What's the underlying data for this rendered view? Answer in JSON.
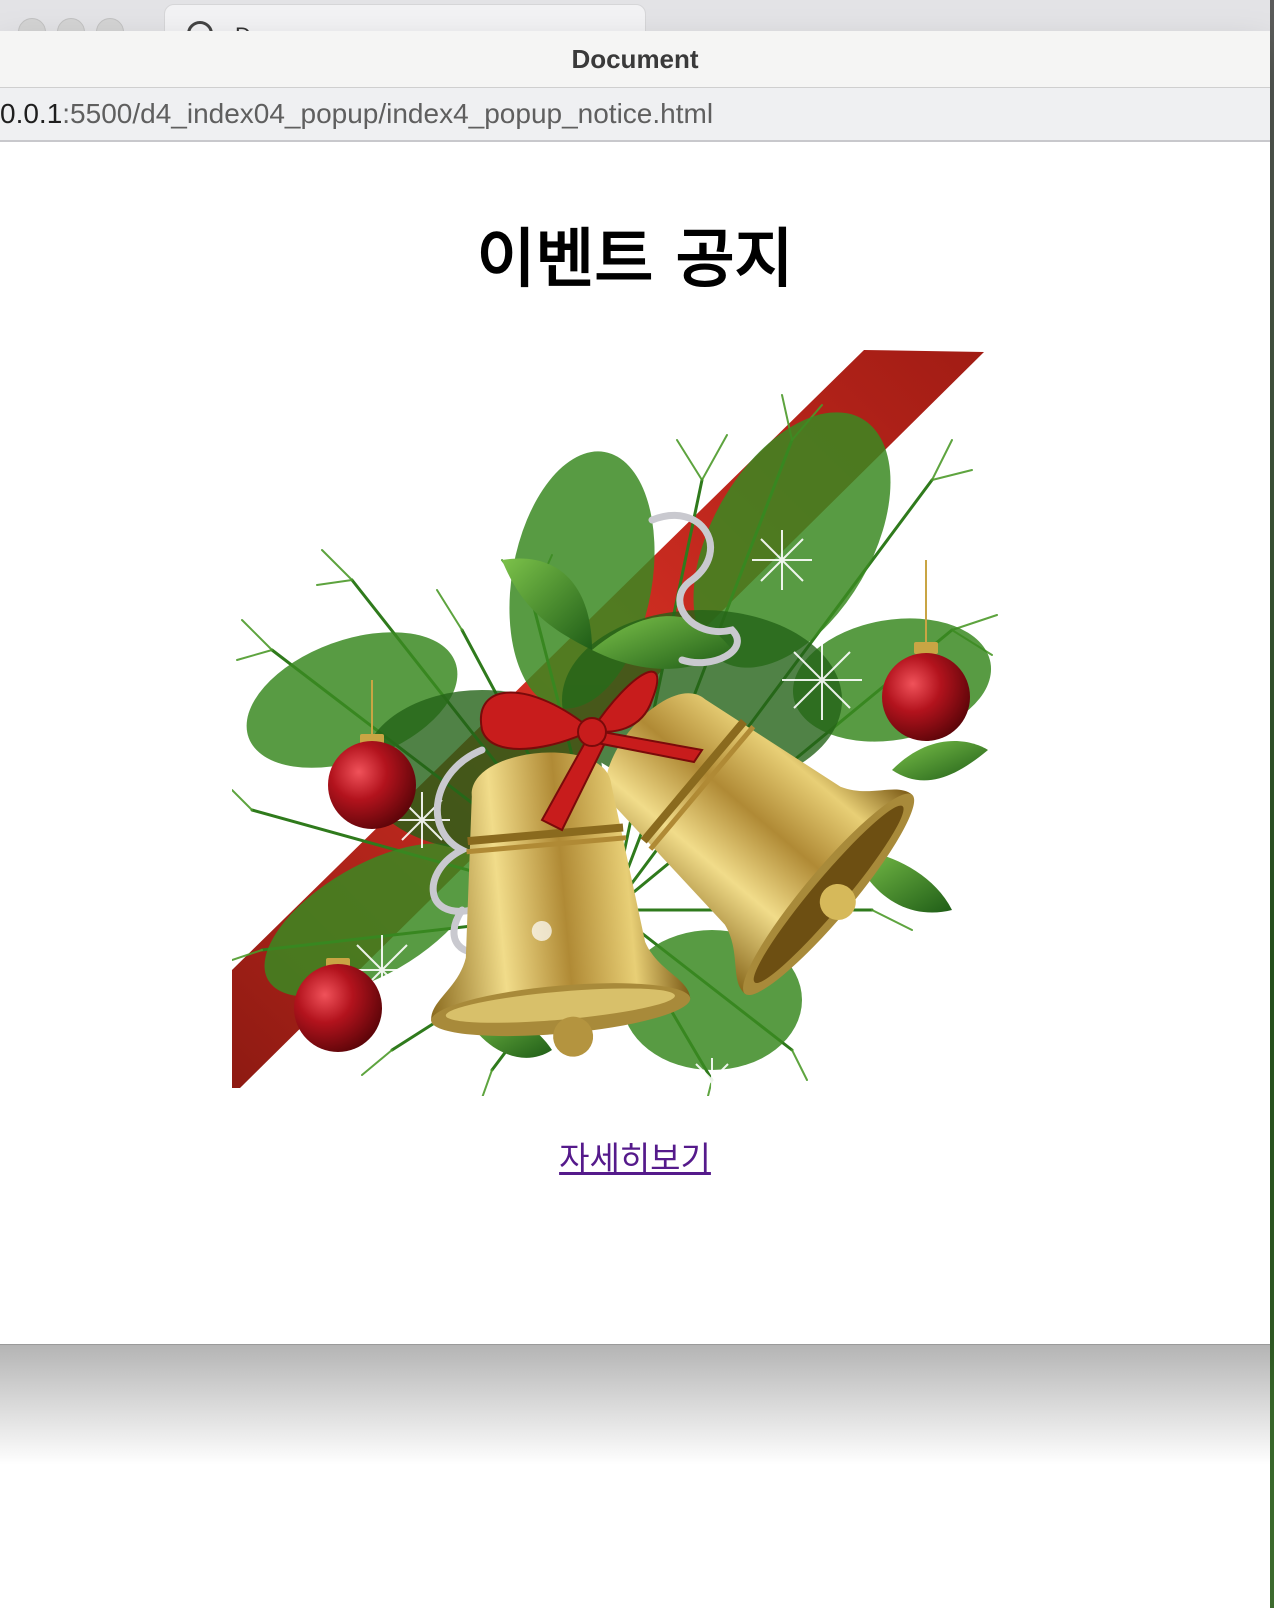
{
  "window": {
    "title": "Document",
    "url_host": "0.0.1",
    "url_path": ":5500/d4_index04_popup/index4_popup_notice.html"
  },
  "background_tab": {
    "label": "D"
  },
  "page": {
    "heading": "이벤트 공지",
    "image_description_icon": "christmas-bells-icon",
    "link_label": "자세히보기"
  },
  "colors": {
    "ribbon": "#c0271d",
    "pine": "#2f7a1c",
    "bell_gold": "#c9a544",
    "ornament": "#b0141c",
    "link": "#551a8b"
  }
}
